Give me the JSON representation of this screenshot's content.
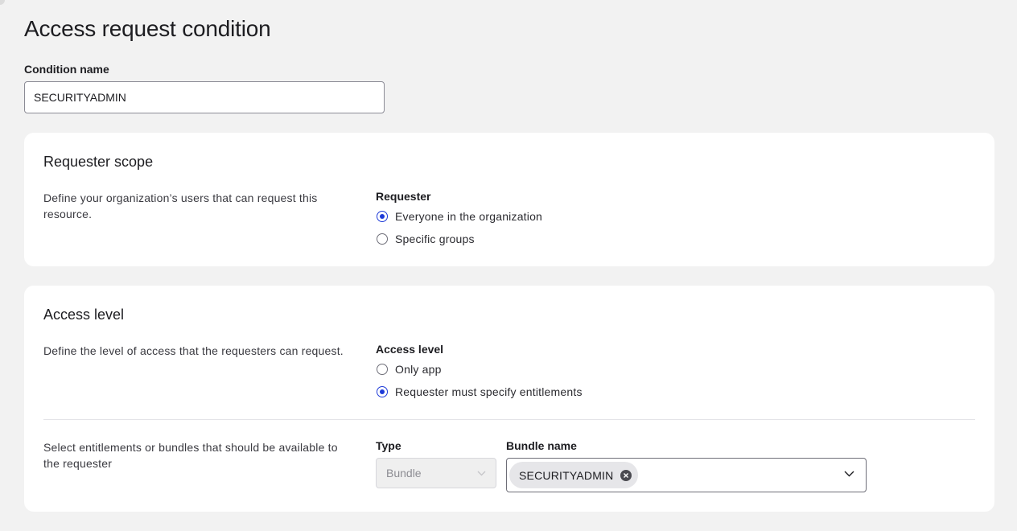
{
  "page": {
    "title": "Access request condition"
  },
  "condition_name": {
    "label": "Condition name",
    "value": "SECURITYADMIN"
  },
  "requester_scope": {
    "title": "Requester scope",
    "description": "Define your organization’s users that can request this resource.",
    "group_label": "Requester",
    "options": [
      {
        "label": "Everyone in the organization",
        "selected": true
      },
      {
        "label": "Specific groups",
        "selected": false
      }
    ]
  },
  "access_level": {
    "title": "Access level",
    "description": "Define the level of access that the requesters can request.",
    "group_label": "Access level",
    "options": [
      {
        "label": "Only app",
        "selected": false
      },
      {
        "label": "Requester must specify entitlements",
        "selected": true
      }
    ],
    "entitlements": {
      "description": "Select entitlements or bundles that should be available to the requester",
      "type_label": "Type",
      "type_value": "Bundle",
      "type_disabled": true,
      "bundle_label": "Bundle name",
      "bundle_chips": [
        "SECURITYADMIN"
      ]
    }
  },
  "colors": {
    "background": "#f2f2f2",
    "card": "#ffffff",
    "accent": "#1e3bd8",
    "text": "#1d1d21"
  },
  "icons": {
    "chevron": "chevron-down-icon",
    "chip_remove": "close-circle-icon"
  }
}
